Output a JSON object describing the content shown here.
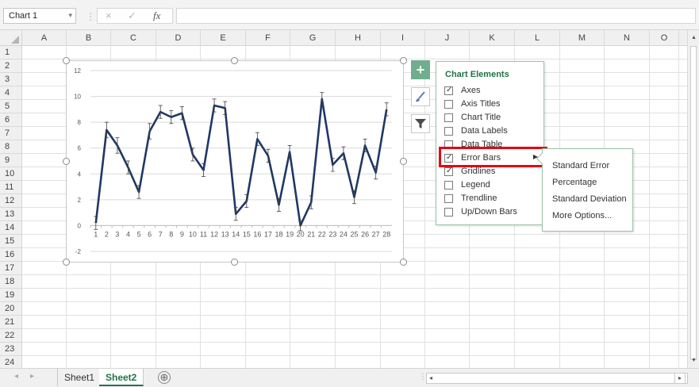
{
  "formula_bar": {
    "name_box": "Chart 1",
    "cancel_icon": "×",
    "enter_icon": "✓",
    "fx_icon": "fx",
    "formula": ""
  },
  "columns": [
    "A",
    "B",
    "C",
    "D",
    "E",
    "F",
    "G",
    "H",
    "I",
    "J",
    "K",
    "L",
    "M",
    "N",
    "O"
  ],
  "rows": [
    "1",
    "2",
    "3",
    "4",
    "5",
    "6",
    "7",
    "8",
    "9",
    "10",
    "11",
    "12",
    "13",
    "14",
    "15",
    "16",
    "17",
    "18",
    "19",
    "20",
    "21",
    "22",
    "23",
    "24"
  ],
  "chart_data": {
    "type": "line",
    "categories": [
      "1",
      "2",
      "3",
      "4",
      "5",
      "6",
      "7",
      "8",
      "9",
      "10",
      "11",
      "12",
      "13",
      "14",
      "15",
      "16",
      "17",
      "18",
      "19",
      "20",
      "21",
      "22",
      "23",
      "24",
      "25",
      "26",
      "27",
      "28"
    ],
    "series": [
      {
        "values": [
          0.2,
          7.4,
          6.2,
          4.5,
          2.6,
          7.3,
          8.8,
          8.4,
          8.7,
          5.5,
          4.3,
          9.3,
          9.1,
          0.9,
          1.9,
          6.7,
          5.4,
          1.6,
          5.7,
          0.0,
          1.8,
          9.8,
          4.7,
          5.6,
          2.2,
          6.2,
          4.1,
          9.0
        ],
        "errors": [
          0.5,
          0.6,
          0.6,
          0.5,
          0.5,
          0.6,
          0.5,
          0.5,
          0.5,
          0.5,
          0.5,
          0.5,
          0.5,
          0.5,
          0.5,
          0.5,
          0.5,
          0.5,
          0.5,
          0.4,
          0.5,
          0.5,
          0.5,
          0.5,
          0.5,
          0.5,
          0.5,
          0.5
        ],
        "color": "#1f3864"
      }
    ],
    "y_ticks": [
      "12",
      "10",
      "8",
      "6",
      "4",
      "2",
      "0",
      "-2"
    ],
    "ylim": [
      -2,
      12
    ],
    "grid": true,
    "title": "",
    "xlabel": "",
    "ylabel": ""
  },
  "chart_elements": {
    "title": "Chart Elements",
    "items": [
      {
        "label": "Axes",
        "checked": true
      },
      {
        "label": "Axis Titles",
        "checked": false
      },
      {
        "label": "Chart Title",
        "checked": false
      },
      {
        "label": "Data Labels",
        "checked": false
      },
      {
        "label": "Data Table",
        "checked": false
      },
      {
        "label": "Error Bars",
        "checked": true,
        "has_submenu": true
      },
      {
        "label": "Gridlines",
        "checked": true
      },
      {
        "label": "Legend",
        "checked": false
      },
      {
        "label": "Trendline",
        "checked": false
      },
      {
        "label": "Up/Down Bars",
        "checked": false
      }
    ]
  },
  "error_bars_submenu": [
    "Standard Error",
    "Percentage",
    "Standard Deviation",
    "More Options..."
  ],
  "sheet_tabs": [
    {
      "label": "Sheet1",
      "active": false
    },
    {
      "label": "Sheet2",
      "active": true
    }
  ],
  "add_sheet_label": "⊕",
  "colors": {
    "accent": "#217346",
    "line": "#1f3864",
    "highlight": "#e30613"
  }
}
